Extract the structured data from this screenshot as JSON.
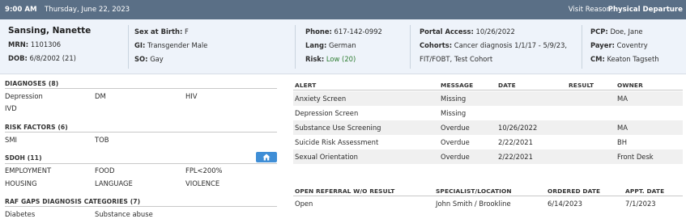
{
  "topbar": {
    "time": "9:00 AM",
    "date": "Thursday, June 22, 2023",
    "visit_reason_label": "Visit Reason:",
    "visit_reason_value": "Physical Departure"
  },
  "patient": {
    "name": "Sansing, Nanette",
    "mrn_label": "MRN:",
    "mrn": "1101306",
    "dob_label": "DOB:",
    "dob": "6/8/2002 (21)",
    "sex_label": "Sex at Birth:",
    "sex": "F",
    "gi_label": "GI:",
    "gi": "Transgender Male",
    "so_label": "SO:",
    "so": "Gay",
    "phone_label": "Phone:",
    "phone": "617-142-0992",
    "lang_label": "Lang:",
    "lang": "German",
    "risk_label": "Risk:",
    "risk": "Low (20)",
    "portal_label": "Portal Access:",
    "portal": "10/26/2022",
    "cohorts_label": "Cohorts:",
    "cohorts_line1": "Cancer diagnosis 1/1/17 - 5/9/23,",
    "cohorts_line2": "FIT/FOBT, Test Cohort",
    "pcp_label": "PCP:",
    "pcp": "Doe, Jane",
    "payer_label": "Payer:",
    "payer": "Coventry",
    "cm_label": "CM:",
    "cm": "Keaton Tagseth",
    "risk_color": "#2e7d32"
  },
  "diagnoses": {
    "title": "DIAGNOSES (8)",
    "items": [
      "Depression",
      "DM",
      "HIV",
      "IVD"
    ]
  },
  "risk_factors": {
    "title": "RISK FACTORS (6)",
    "items": [
      "SMI",
      "TOB"
    ]
  },
  "sdoh": {
    "title": "SDOH (11)",
    "items": [
      "EMPLOYMENT",
      "FOOD",
      "FPL<200%",
      "HOUSING",
      "LANGUAGE",
      "VIOLENCE"
    ],
    "button_icon": "house-icon"
  },
  "raf": {
    "title": "RAF GAPS DIAGNOSIS CATEGORIES (7)",
    "items": [
      "Diabetes",
      "Substance abuse"
    ]
  },
  "alerts": {
    "headers": [
      "ALERT",
      "MESSAGE",
      "DATE",
      "RESULT",
      "OWNER"
    ],
    "rows": [
      {
        "alert": "Anxiety Screen",
        "message": "Missing",
        "date": "",
        "result": "",
        "owner": "MA"
      },
      {
        "alert": "Depression Screen",
        "message": "Missing",
        "date": "",
        "result": "",
        "owner": ""
      },
      {
        "alert": "Substance Use Screening",
        "message": "Overdue",
        "date": "10/26/2022",
        "result": "",
        "owner": "MA"
      },
      {
        "alert": "Suicide Risk Assessment",
        "message": "Overdue",
        "date": "2/22/2021",
        "result": "",
        "owner": "BH"
      },
      {
        "alert": "Sexual Orientation",
        "message": "Overdue",
        "date": "2/22/2021",
        "result": "",
        "owner": "Front Desk"
      }
    ]
  },
  "referrals": {
    "headers": [
      "OPEN REFERRAL W/O RESULT",
      "SPECIALIST/LOCATION",
      "ORDERED DATE",
      "APPT. DATE"
    ],
    "rows": [
      {
        "status": "Open",
        "specialist": "John Smith / Brookline",
        "ordered": "6/14/2023",
        "appt": "7/1/2023"
      }
    ]
  }
}
